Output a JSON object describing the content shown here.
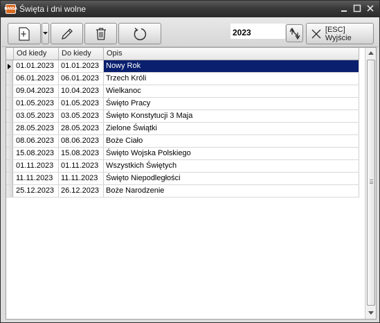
{
  "window": {
    "title": "Święta i dni wolne",
    "app_icon_text": "HANSA"
  },
  "toolbar": {
    "year_value": "2023",
    "exit_label": "[ESC] Wyjście"
  },
  "grid": {
    "columns": [
      "Od kiedy",
      "Do kiedy",
      "Opis"
    ],
    "rows": [
      {
        "from": "01.01.2023",
        "to": "01.01.2023",
        "opis": "Nowy Rok"
      },
      {
        "from": "06.01.2023",
        "to": "06.01.2023",
        "opis": "Trzech Króli"
      },
      {
        "from": "09.04.2023",
        "to": "10.04.2023",
        "opis": "Wielkanoc"
      },
      {
        "from": "01.05.2023",
        "to": "01.05.2023",
        "opis": "Święto Pracy"
      },
      {
        "from": "03.05.2023",
        "to": "03.05.2023",
        "opis": "Święto Konstytucji 3 Maja"
      },
      {
        "from": "28.05.2023",
        "to": "28.05.2023",
        "opis": "Zielone Świątki"
      },
      {
        "from": "08.06.2023",
        "to": "08.06.2023",
        "opis": "Boże Ciało"
      },
      {
        "from": "15.08.2023",
        "to": "15.08.2023",
        "opis": "Święto Wojska Polskiego"
      },
      {
        "from": "01.11.2023",
        "to": "01.11.2023",
        "opis": "Wszystkich Świętych"
      },
      {
        "from": "11.11.2023",
        "to": "11.11.2023",
        "opis": "Święto Niepodległości"
      },
      {
        "from": "25.12.2023",
        "to": "26.12.2023",
        "opis": "Boże Narodzenie"
      }
    ],
    "selected_row_index": 0,
    "selection_color": "#0a1f6e"
  },
  "icons": {
    "app": "app-logo-icon",
    "new": "new-document-icon",
    "edit": "pencil-icon",
    "delete": "trash-icon",
    "refresh": "refresh-icon",
    "spin": "sort-arrows-icon",
    "exit": "close-x-icon"
  }
}
